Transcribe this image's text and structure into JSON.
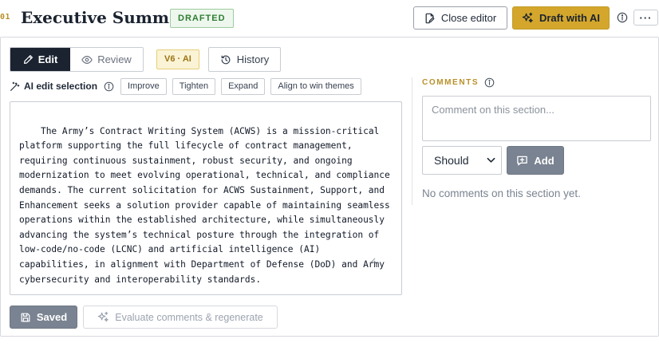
{
  "header": {
    "section_number": "01",
    "title": "Executive Summary",
    "status_badge": "DRAFTED",
    "close_editor_label": "Close editor",
    "draft_ai_label": "Draft with AI",
    "more_label": "···"
  },
  "tabs": [
    {
      "label": "Edit",
      "active": true,
      "icon": "pencil-icon"
    },
    {
      "label": "Review",
      "active": false,
      "icon": "eye-icon"
    }
  ],
  "version_badge": "V6 · AI",
  "history_label": "History",
  "ai_edit": {
    "label": "AI edit selection",
    "actions": [
      "Improve",
      "Tighten",
      "Expand",
      "Align to win themes"
    ]
  },
  "editor": {
    "content": "The Army’s Contract Writing System (ACWS) is a mission-critical platform supporting the full lifecycle of contract management, requiring continuous sustainment, robust security, and ongoing modernization to meet evolving operational, technical, and compliance demands. The current solicitation for ACWS Sustainment, Support, and Enhancement seeks a solution provider capable of maintaining seamless operations within the established architecture, while simultaneously advancing the system’s technical posture through the integration of low-code/no-code (LCNC) and artificial intelligence (AI) capabilities, in alignment with Department of Defense (DoD) and Army cybersecurity and interoperability standards."
  },
  "footer": {
    "saved_label": "Saved",
    "evaluate_label": "Evaluate comments & regenerate"
  },
  "comments": {
    "heading": "COMMENTS",
    "placeholder": "Comment on this section...",
    "priority_selected": "Should",
    "add_label": "Add",
    "empty_text": "No comments on this section yet."
  },
  "colors": {
    "accent_gold": "#d4a72c",
    "dark_navy": "#1b2330",
    "drafted_green": "#2e7d32",
    "muted_gray": "#7a8391"
  }
}
